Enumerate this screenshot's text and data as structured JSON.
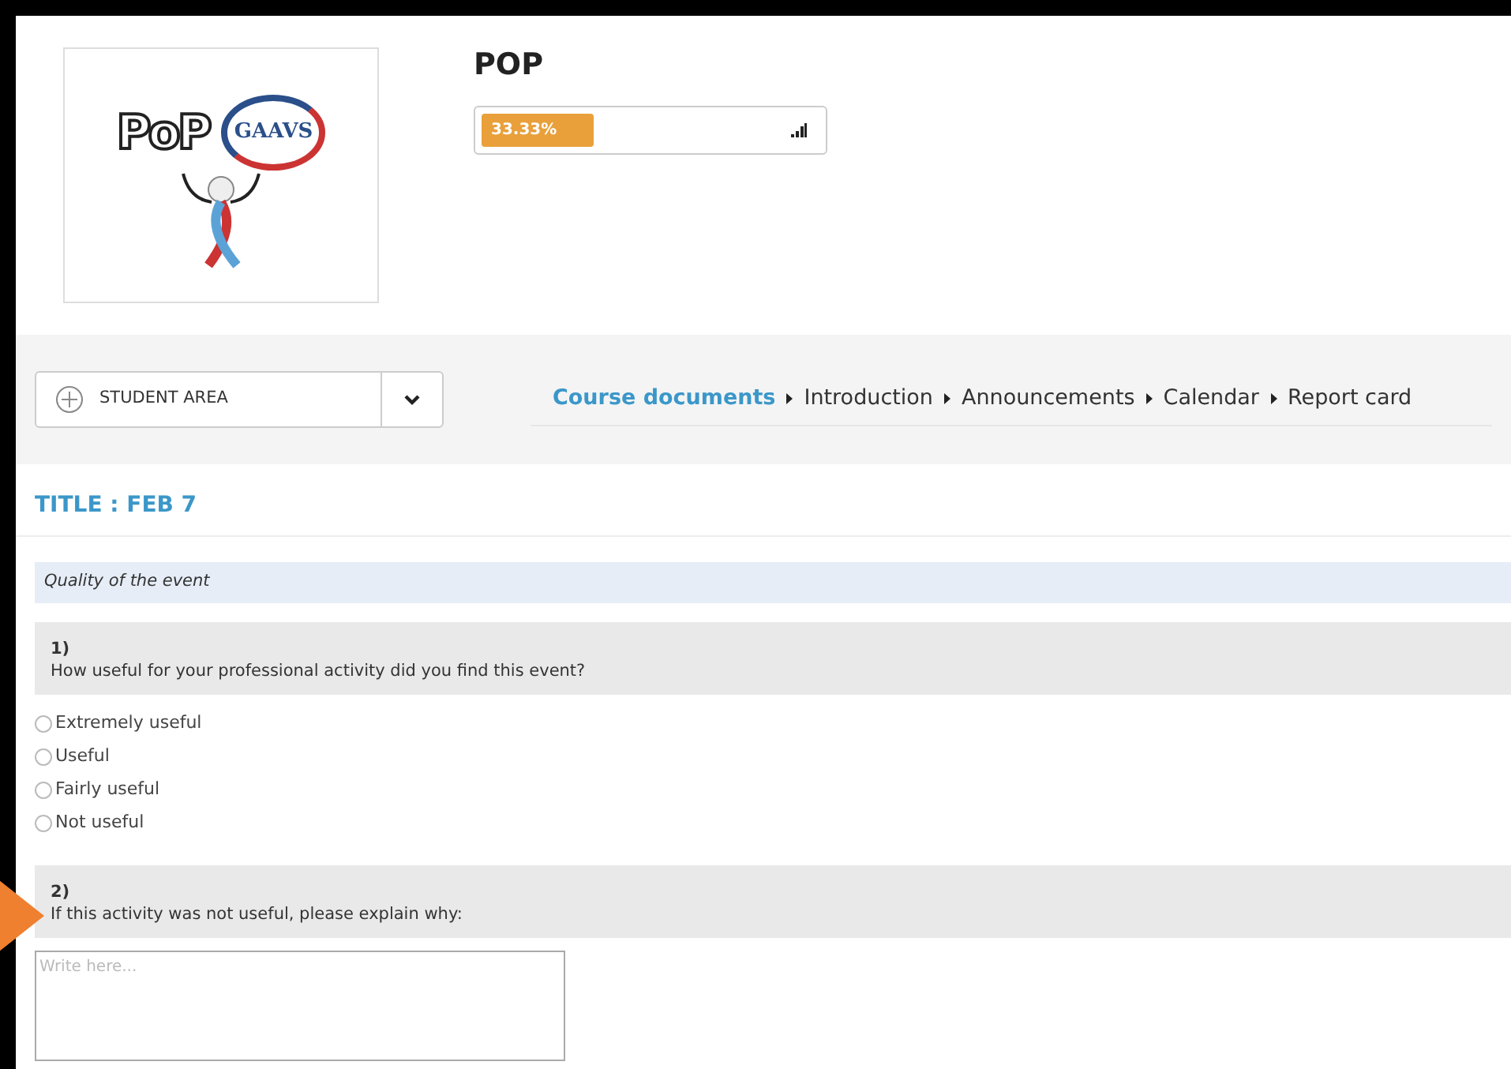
{
  "logo": {
    "word_left": "PoP",
    "word_right": "GAAVS"
  },
  "course": {
    "title": "POP",
    "progress": {
      "label": "33.33%",
      "level": 0.3333
    }
  },
  "area_menu": {
    "label": "STUDENT AREA"
  },
  "breadcrumb": [
    {
      "label": "Course documents",
      "selected": true
    },
    {
      "label": "Introduction",
      "selected": false
    },
    {
      "label": "Announcements",
      "selected": false
    },
    {
      "label": "Calendar",
      "selected": false
    },
    {
      "label": "Report card",
      "selected": false
    }
  ],
  "survey": {
    "title": "TITLE : FEB 7",
    "section": "Quality of the event",
    "questions": [
      {
        "kind": "radio",
        "number": "1)",
        "text": "How useful for your professional activity did you find this event?",
        "options": [
          {
            "label": "Extremely useful",
            "selected": false
          },
          {
            "label": "Useful",
            "selected": false
          },
          {
            "label": "Fairly useful",
            "selected": false
          },
          {
            "label": "Not useful",
            "selected": false
          }
        ]
      },
      {
        "kind": "text",
        "number": "2)",
        "text": "If this activity was not useful, please explain why:",
        "placeholder": "Write here..."
      }
    ]
  }
}
